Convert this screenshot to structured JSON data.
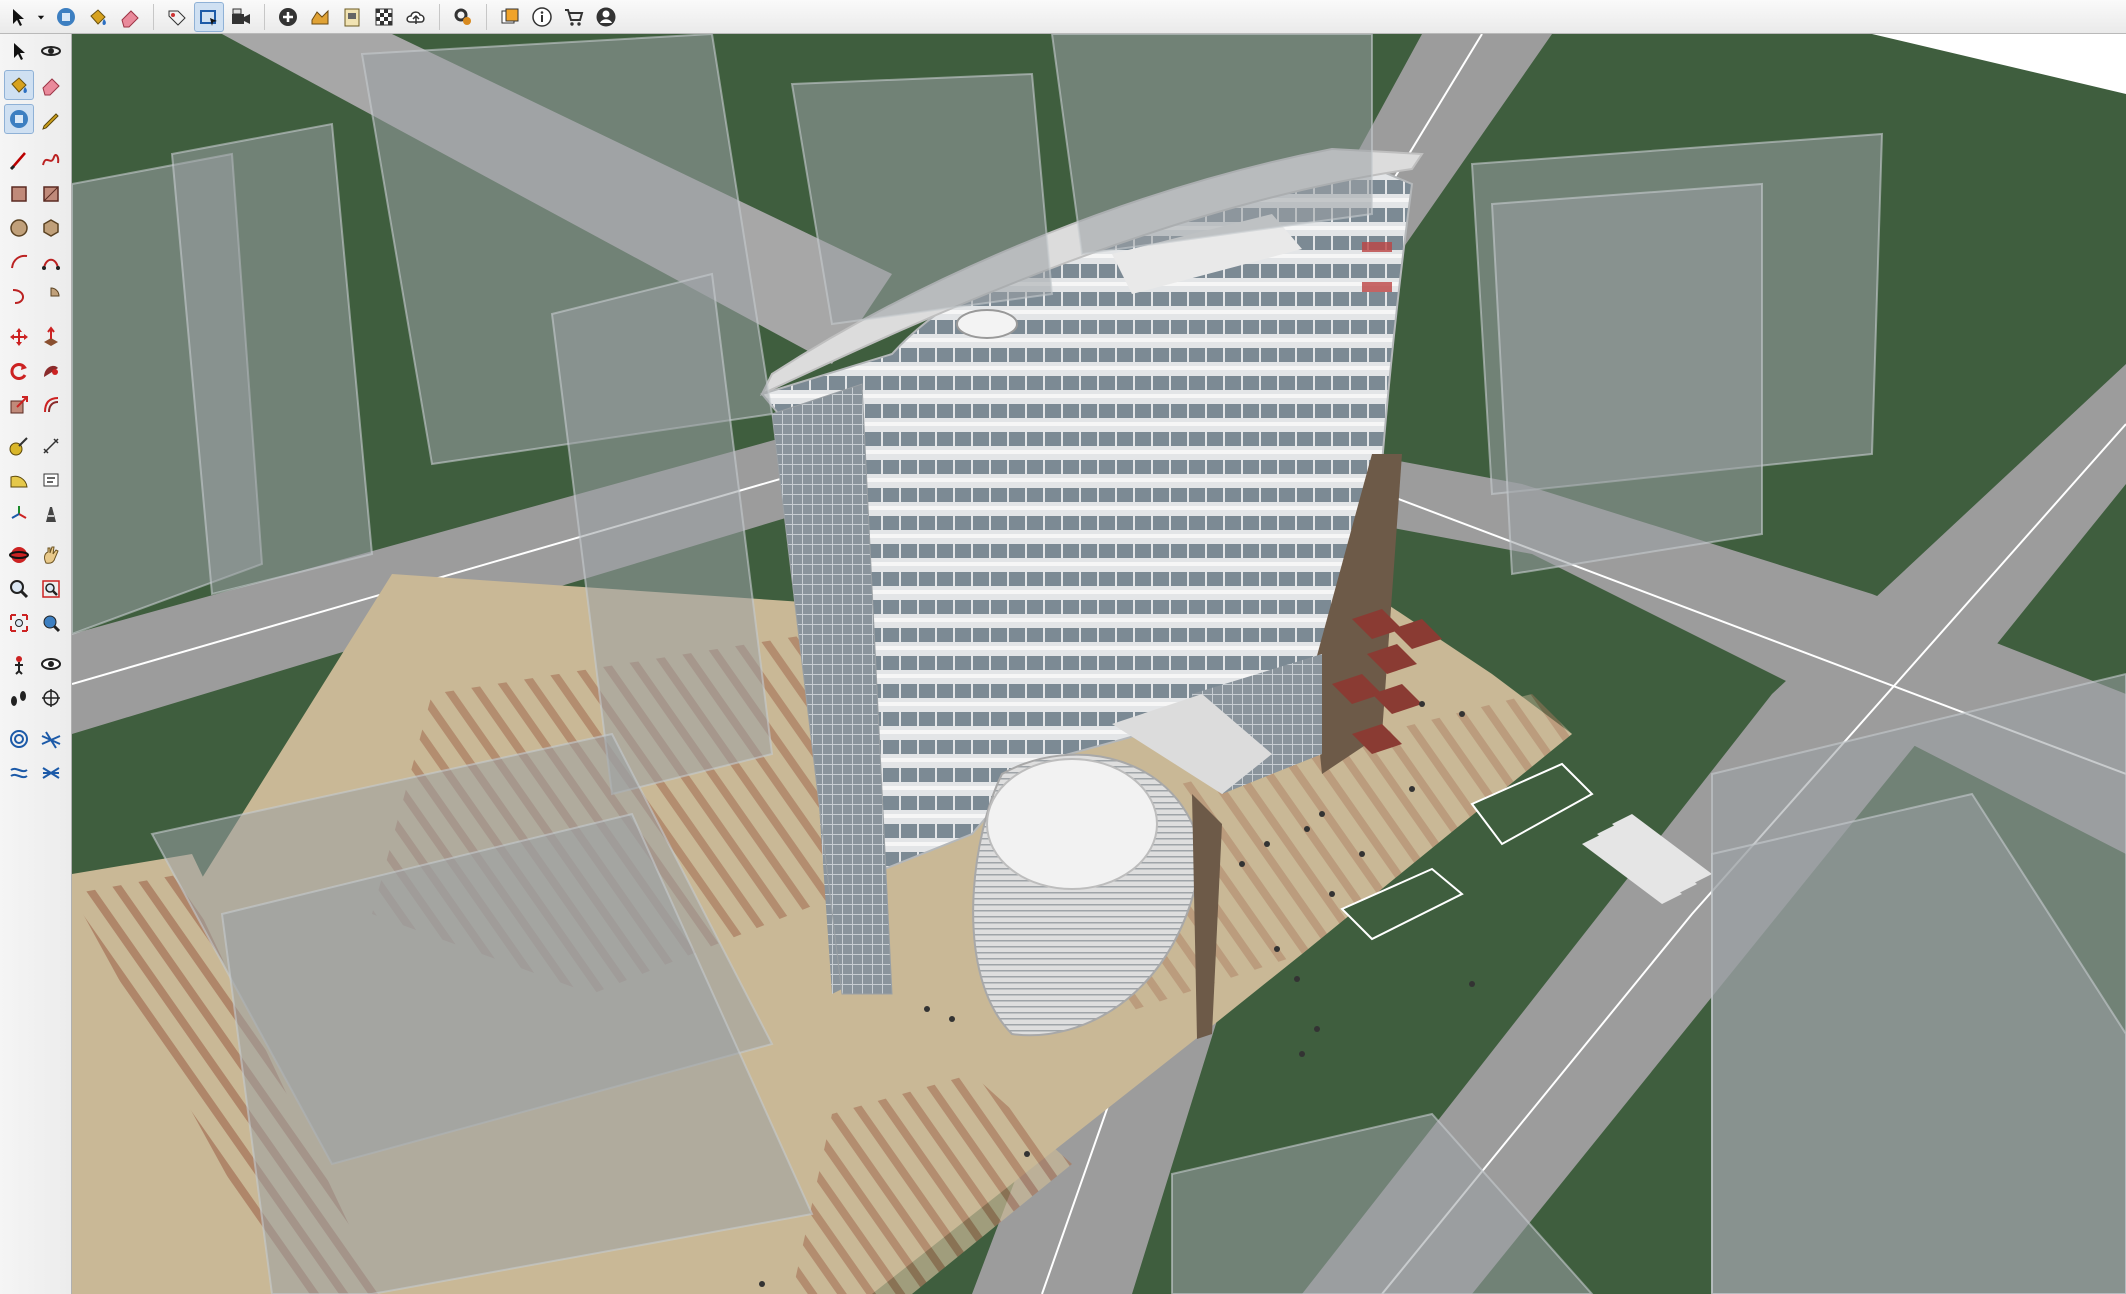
{
  "toolbar": {
    "groups": [
      [
        "select-icon",
        "select-dropdown-icon",
        "make-component-icon",
        "paint-bucket-icon",
        "eraser-icon"
      ],
      [
        "tag-tool-icon",
        "rectangle-select-icon",
        "camera-icon"
      ],
      [
        "add-location-icon",
        "sandbox-icon",
        "layout-icon",
        "photo-textures-icon",
        "cloud-upload-icon"
      ],
      [
        "extension-settings-icon"
      ],
      [
        "model-info-icon",
        "info-icon",
        "extension-warehouse-icon",
        "account-icon"
      ]
    ],
    "active": "rectangle-select-icon"
  },
  "left_tools": {
    "rows": [
      [
        "select-icon",
        "orbit-icon"
      ],
      [
        "paint-bucket-icon",
        "eraser-icon"
      ],
      [
        "make-component-icon",
        "tape-pencil-icon"
      ],
      [
        "line-icon",
        "freehand-icon"
      ],
      [
        "rectangle-icon",
        "rotated-rectangle-icon"
      ],
      [
        "circle-icon",
        "polygon-icon"
      ],
      [
        "arc-icon",
        "two-point-arc-icon"
      ],
      [
        "three-point-arc-icon",
        "pie-icon"
      ],
      [
        "move-icon",
        "push-pull-icon"
      ],
      [
        "rotate-icon",
        "follow-me-icon"
      ],
      [
        "scale-icon",
        "offset-icon"
      ],
      [
        "tape-measure-icon",
        "dimension-icon"
      ],
      [
        "protractor-icon",
        "text-icon"
      ],
      [
        "axes-icon",
        "3d-text-icon"
      ],
      [
        "orbit-view-icon",
        "pan-icon"
      ],
      [
        "zoom-icon",
        "zoom-window-icon"
      ],
      [
        "zoom-extents-icon",
        "previous-view-icon"
      ],
      [
        "position-camera-icon",
        "look-around-icon"
      ],
      [
        "walk-icon",
        "section-plane-icon"
      ],
      [
        "sandbox-from-contours-icon",
        "sandbox-scratch-icon"
      ],
      [
        "smoove-icon",
        "stamp-icon"
      ]
    ],
    "gap_before_rows": [
      3,
      8,
      11,
      14,
      17,
      19
    ],
    "active": [
      "paint-bucket-icon",
      "make-component-icon"
    ]
  },
  "scene": {
    "colors": {
      "grass": "#3f5e3e",
      "road": "#9c9c9c",
      "road_lane": "#ffffff",
      "plaza": "#c9b896",
      "plaza_stripe": "#a97a5e",
      "building": "#d7d9db",
      "glass": "#7c8a94",
      "ghost_block": "#9aa1a4"
    }
  }
}
